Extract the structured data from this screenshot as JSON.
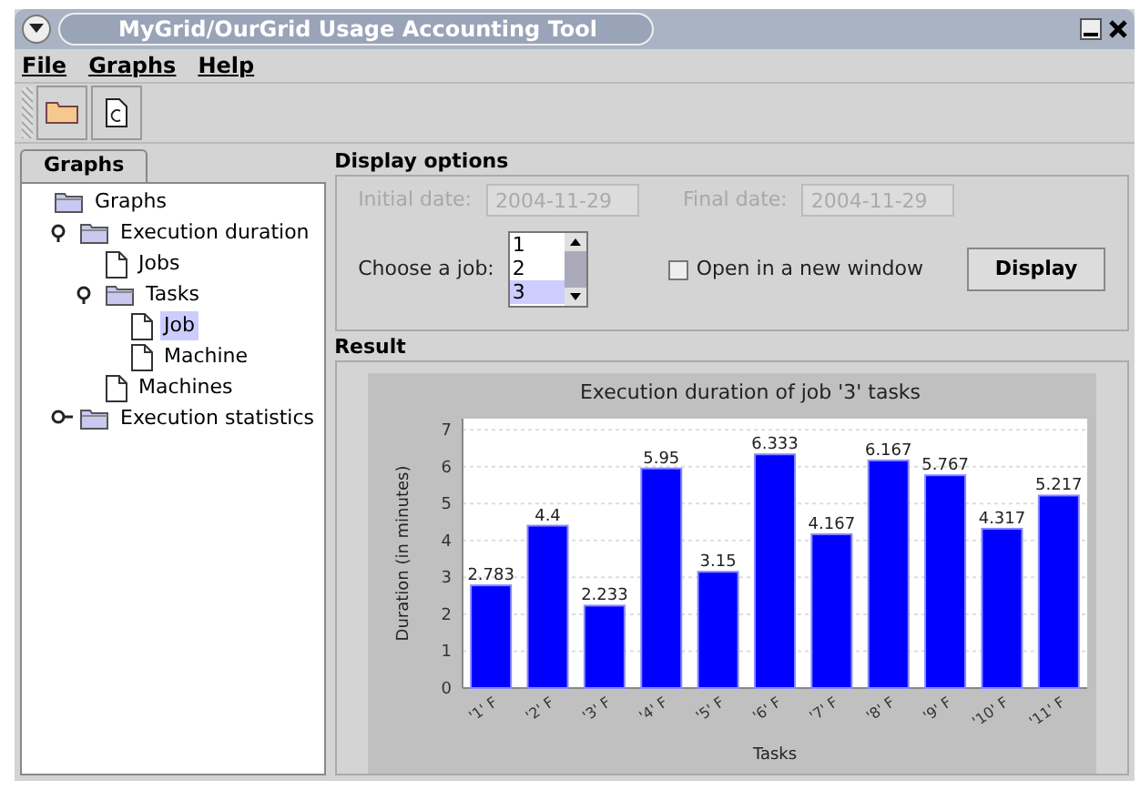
{
  "window": {
    "title": "MyGrid/OurGrid Usage Accounting Tool"
  },
  "menu": [
    "File",
    "Graphs",
    "Help"
  ],
  "sidebar": {
    "tab": "Graphs",
    "tree": [
      {
        "label": "Graphs",
        "kind": "folder",
        "selected": false,
        "children": [
          {
            "label": "Execution duration",
            "kind": "folder",
            "expanded": true,
            "selected": false,
            "children": [
              {
                "label": "Jobs",
                "kind": "leaf",
                "selected": false
              },
              {
                "label": "Tasks",
                "kind": "folder",
                "expanded": true,
                "selected": false,
                "children": [
                  {
                    "label": "Job",
                    "kind": "leaf",
                    "selected": true
                  },
                  {
                    "label": "Machine",
                    "kind": "leaf",
                    "selected": false
                  }
                ]
              },
              {
                "label": "Machines",
                "kind": "leaf",
                "selected": false
              }
            ]
          },
          {
            "label": "Execution statistics",
            "kind": "folder",
            "expanded": false,
            "selected": false
          }
        ]
      }
    ]
  },
  "display_options": {
    "title": "Display options",
    "initial_date": {
      "label": "Initial date:",
      "value": "2004-11-29",
      "disabled": true
    },
    "final_date": {
      "label": "Final date:",
      "value": "2004-11-29",
      "disabled": true
    },
    "job_label": "Choose a job:",
    "jobs": [
      {
        "label": "1",
        "selected": false
      },
      {
        "label": "2",
        "selected": false
      },
      {
        "label": "3",
        "selected": true
      }
    ],
    "new_window": {
      "label": "Open in a new window",
      "checked": false
    },
    "button": "Display"
  },
  "result": {
    "title": "Result",
    "chart_data": {
      "type": "bar",
      "title": "Execution duration of job '3' tasks",
      "xlabel": "Tasks",
      "ylabel": "Duration (in minutes)",
      "categories": [
        "'1' F",
        "'2' F",
        "'3' F",
        "'4' F",
        "'5' F",
        "'6' F",
        "'7' F",
        "'8' F",
        "'9' F",
        "'10' F",
        "'11' F"
      ],
      "series": [
        {
          "color": "#0000ff",
          "values": [
            2.783,
            4.4,
            2.233,
            5.95,
            3.15,
            6.333,
            4.167,
            6.167,
            5.767,
            4.317,
            5.217
          ]
        }
      ],
      "ylim": [
        0,
        7.3
      ],
      "yticks": [
        0,
        1,
        2,
        3,
        4,
        5,
        6,
        7
      ],
      "grid": true,
      "data_labels": true
    }
  }
}
